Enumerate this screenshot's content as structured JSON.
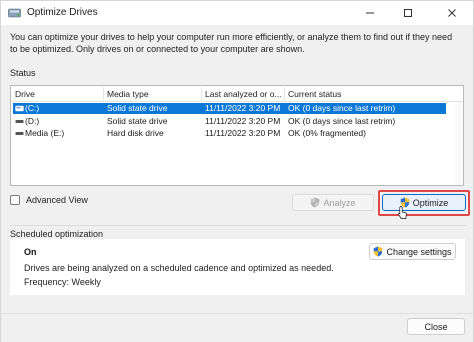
{
  "window": {
    "title": "Optimize Drives",
    "controls": {
      "minimize": "—",
      "maximize": "☐",
      "close": "✕"
    }
  },
  "description": "You can optimize your drives to help your computer run more efficiently, or analyze them to find out if they need to be optimized. Only drives on or connected to your computer are shown.",
  "status": {
    "label": "Status",
    "columns": [
      "Drive",
      "Media type",
      "Last analyzed or o...",
      "Current status"
    ],
    "rows": [
      {
        "drive": "(C:)",
        "media": "Solid state drive",
        "last": "11/11/2022 3:20 PM",
        "status": "OK (0 days since last retrim)",
        "selected": true
      },
      {
        "drive": "(D:)",
        "media": "Solid state drive",
        "last": "11/11/2022 3:20 PM",
        "status": "OK (0 days since last retrim)",
        "selected": false
      },
      {
        "drive": "Media (E:)",
        "media": "Hard disk drive",
        "last": "11/11/2022 3:20 PM",
        "status": "OK (0% fragmented)",
        "selected": false
      }
    ]
  },
  "advanced_view": {
    "label": "Advanced View",
    "checked": false
  },
  "buttons": {
    "analyze": "Analyze",
    "optimize": "Optimize",
    "change_settings": "Change settings",
    "close": "Close"
  },
  "scheduled": {
    "label": "Scheduled optimization",
    "state": "On",
    "description": "Drives are being analyzed on a scheduled cadence and optimized as needed.",
    "frequency": "Frequency: Weekly"
  },
  "colors": {
    "selection": "#0b78d7",
    "highlight_box": "#e04848",
    "accent": "#0b6ccc"
  },
  "icons": [
    "optimize-drives-app-icon",
    "drive-icon",
    "shield-icon",
    "mouse-pointer-icon"
  ]
}
